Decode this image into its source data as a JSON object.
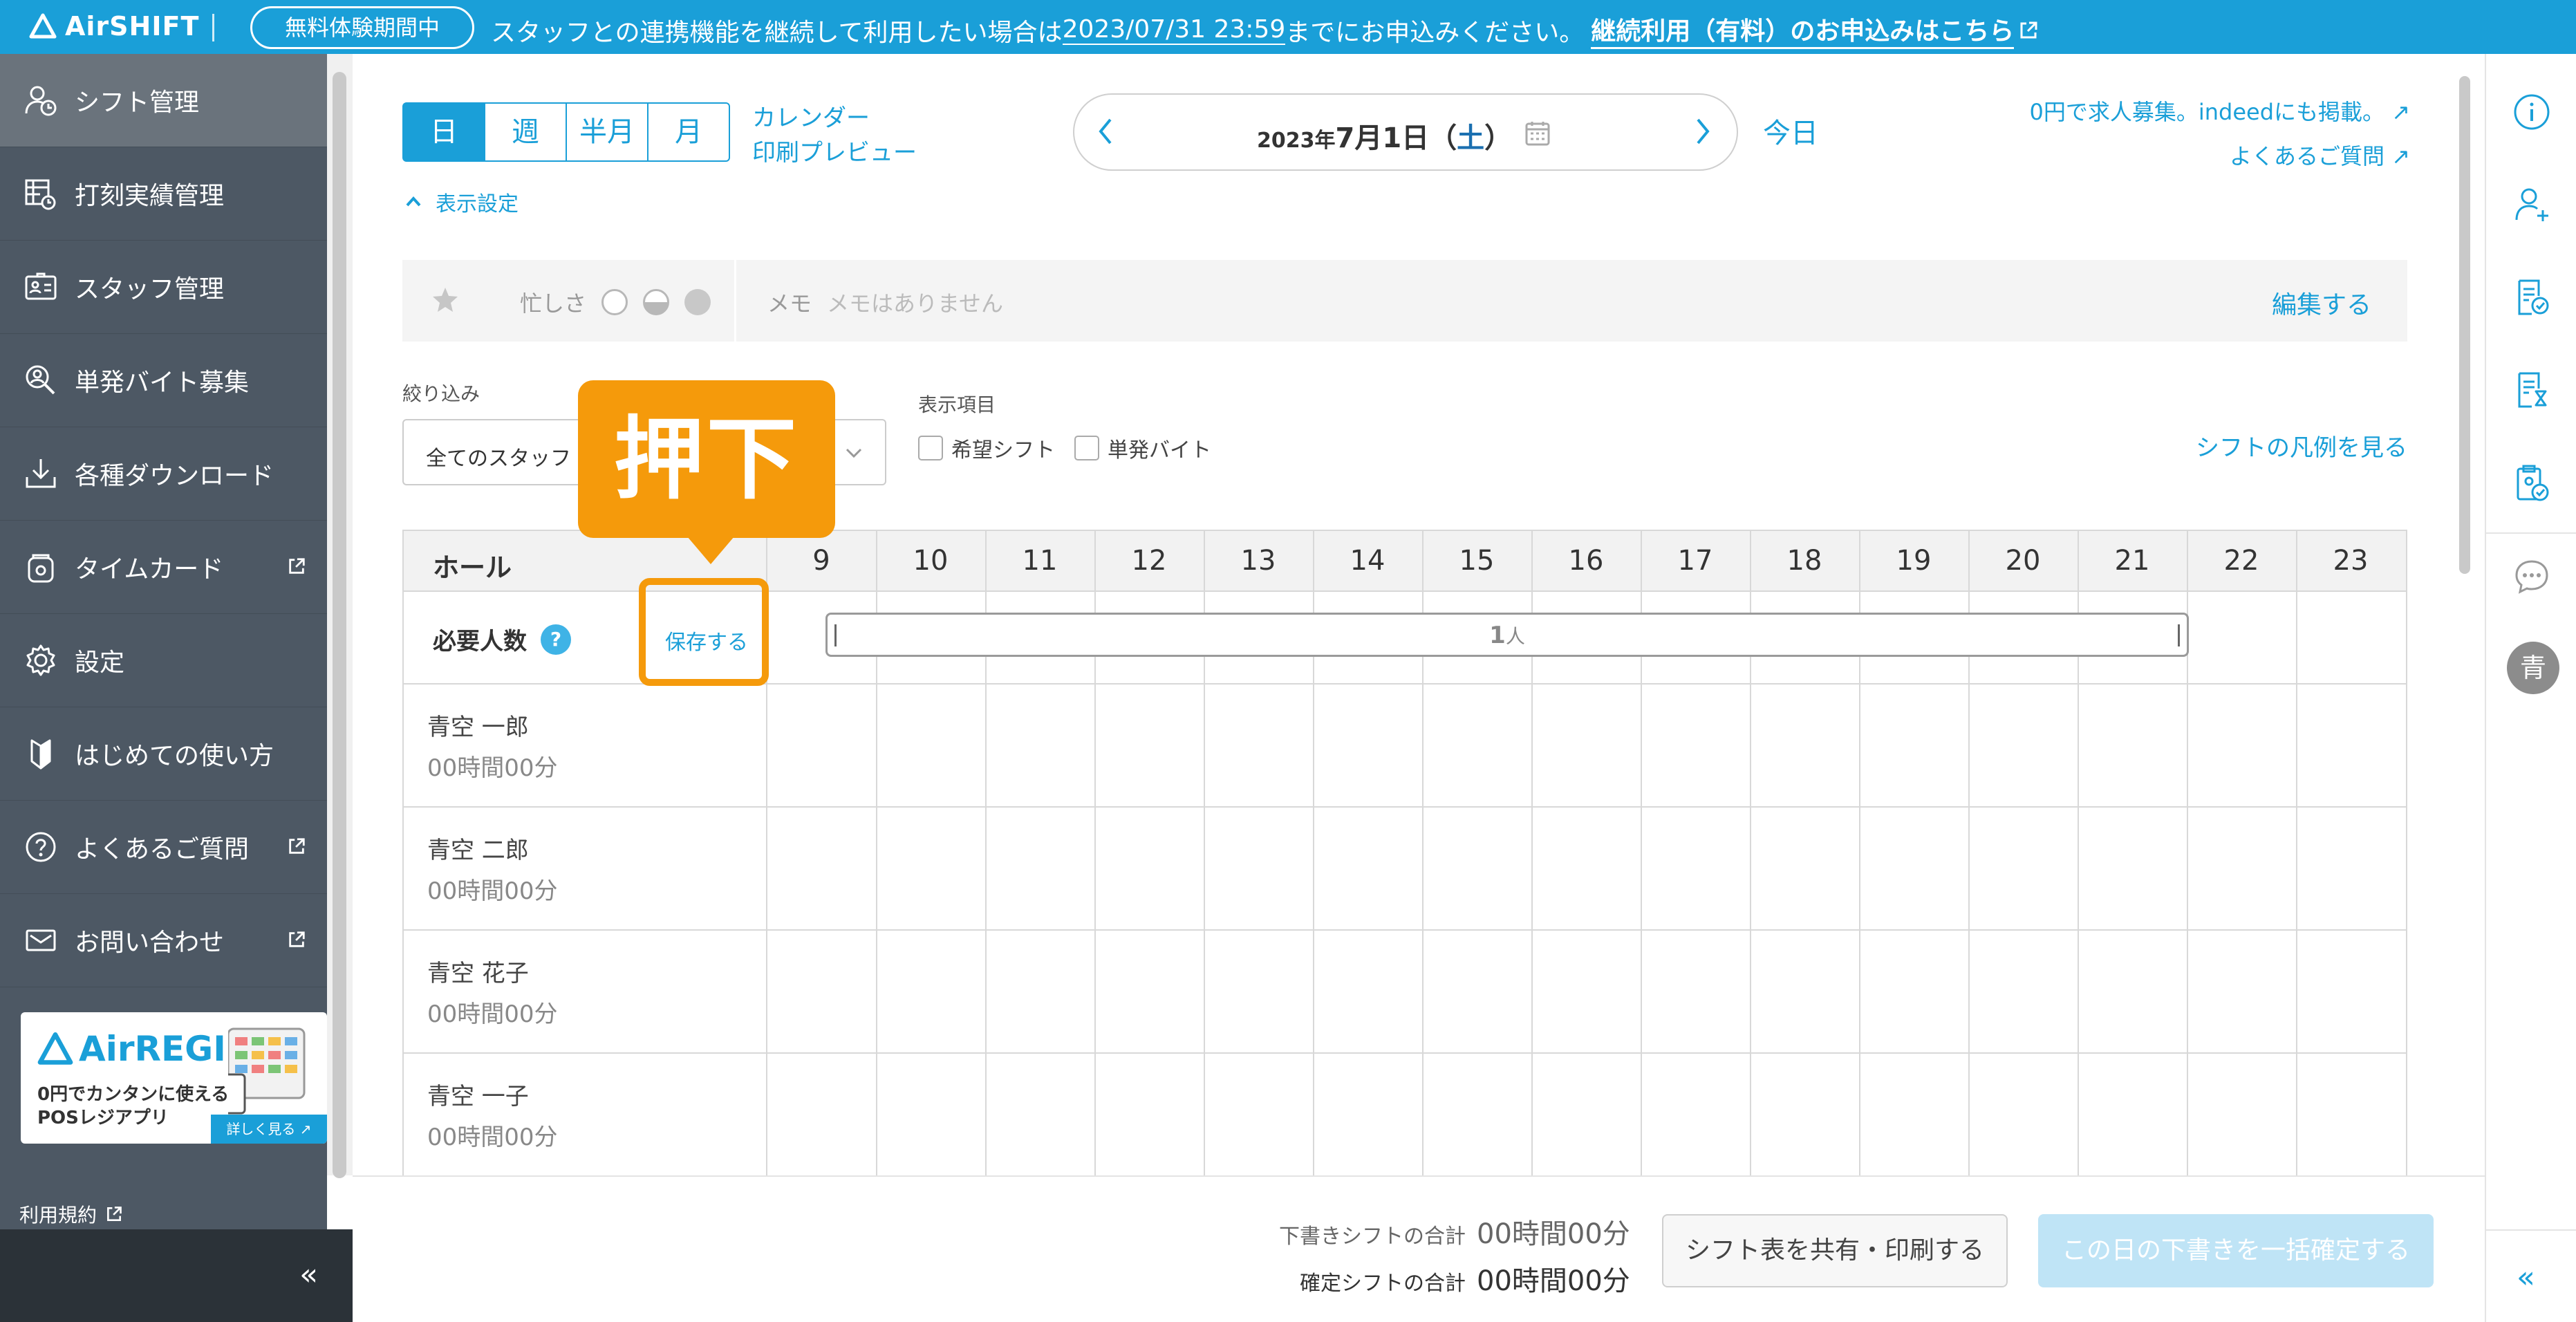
{
  "banner": {
    "logo": "AirSHIFT",
    "trial_badge": "無料体験期間中",
    "message_before": "スタッフとの連携機能を継続して利用したい場合は",
    "deadline": "2023/07/31 23:59",
    "message_after": "までにお申込みください。",
    "cta": "継続利用（有料）のお申込みはこちら"
  },
  "sidebar": {
    "items": [
      {
        "label": "シフト管理"
      },
      {
        "label": "打刻実績管理"
      },
      {
        "label": "スタッフ管理"
      },
      {
        "label": "単発バイト募集"
      },
      {
        "label": "各種ダウンロード"
      },
      {
        "label": "タイムカード"
      },
      {
        "label": "設定"
      },
      {
        "label": "はじめての使い方"
      },
      {
        "label": "よくあるご質問"
      },
      {
        "label": "お問い合わせ"
      }
    ],
    "ad": {
      "logo": "AirREGI",
      "line1": "0円でカンタンに使える",
      "line2": "POSレジアプリ",
      "button": "詳しく見る"
    },
    "terms": "利用規約",
    "collapse": "«"
  },
  "toolbar": {
    "tabs": [
      {
        "label": "日"
      },
      {
        "label": "週"
      },
      {
        "label": "半月"
      },
      {
        "label": "月"
      }
    ],
    "calendar_link": "カレンダー",
    "print_link": "印刷プレビュー",
    "date_year": "2023年",
    "date_day": "7月1日",
    "date_dow_open": "（",
    "date_dow": "土",
    "date_dow_close": "）",
    "today": "今日",
    "job_link": "0円で求人募集。indeedにも掲載。",
    "faq_link": "よくあるご質問",
    "display_settings": "表示設定"
  },
  "memo_strip": {
    "busy_label": "忙しさ",
    "memo_label": "メモ",
    "memo_text": "メモはありません",
    "edit": "編集する"
  },
  "filters": {
    "label": "絞り込み",
    "value": "全てのスタッフ",
    "display_label": "表示項目",
    "check1": "希望シフト",
    "check2": "単発バイト",
    "legend_link": "シフトの凡例を見る"
  },
  "grid": {
    "title": "ホール",
    "hours": [
      "9",
      "10",
      "11",
      "12",
      "13",
      "14",
      "15",
      "16",
      "17",
      "18",
      "19",
      "20",
      "21",
      "22",
      "23"
    ],
    "required_label": "必要人数",
    "help": "?",
    "save": "保存する",
    "required_value": "1",
    "required_unit": "人",
    "staff": [
      {
        "name": "青空 一郎",
        "hours": "00時間00分"
      },
      {
        "name": "青空 二郎",
        "hours": "00時間00分"
      },
      {
        "name": "青空 花子",
        "hours": "00時間00分"
      },
      {
        "name": "青空 一子",
        "hours": "00時間00分"
      }
    ]
  },
  "callout": {
    "text": "押下"
  },
  "footer": {
    "draft_label": "下書きシフトの合計",
    "draft_value": "00時間00分",
    "confirmed_label": "確定シフトの合計",
    "confirmed_value": "00時間00分",
    "share_button": "シフト表を共有・印刷する",
    "confirm_button": "この日の下書きを一括確定する"
  },
  "right_rail": {
    "avatar": "青",
    "collapse": "«"
  },
  "colors": {
    "brand": "#1a9fd8",
    "sidebar": "#4d5864",
    "callout": "#f59a0b"
  }
}
